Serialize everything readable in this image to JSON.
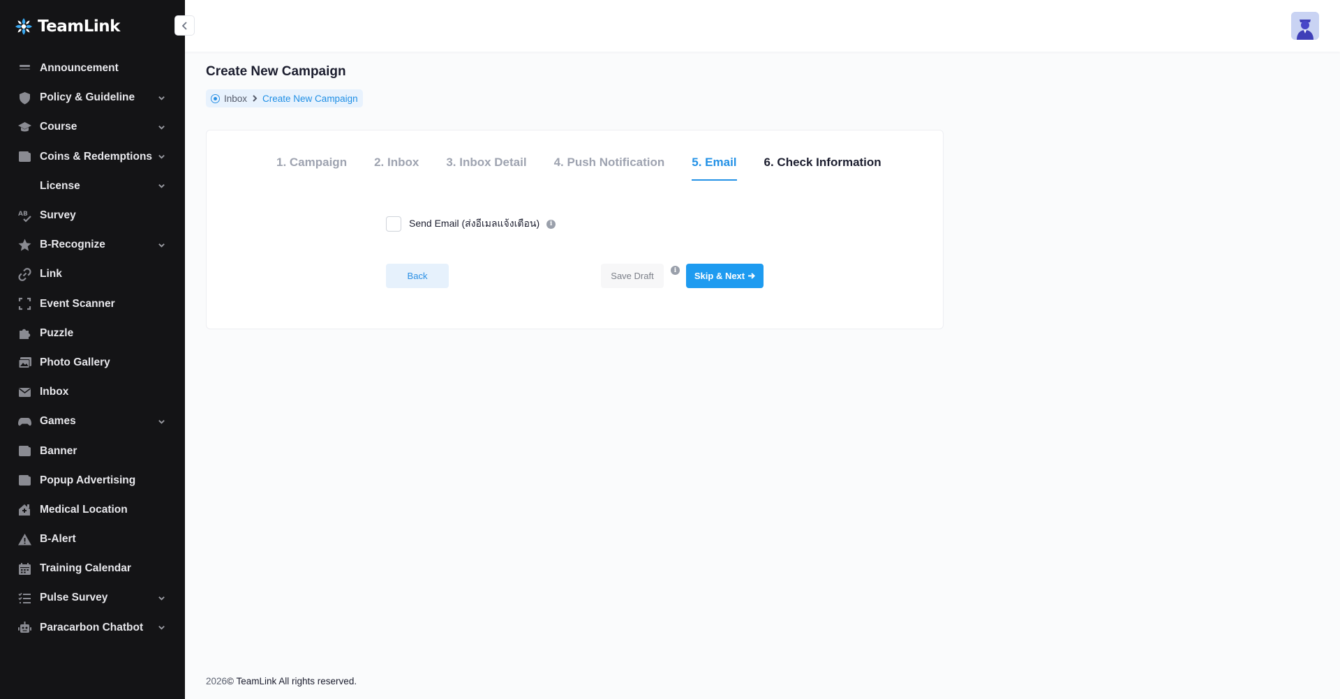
{
  "brand": {
    "name": "TeamLink"
  },
  "sidebar": {
    "items": [
      {
        "label": "Announcement",
        "icon": "announcement-icon",
        "chevron": false
      },
      {
        "label": "Policy & Guideline",
        "icon": "shield-icon",
        "chevron": true
      },
      {
        "label": "Course",
        "icon": "graduation-cap-icon",
        "chevron": true
      },
      {
        "label": "Coins & Redemptions",
        "icon": "wallet-icon",
        "chevron": true
      },
      {
        "label": "License",
        "icon": "",
        "chevron": true
      },
      {
        "label": "Survey",
        "icon": "spellcheck-icon",
        "chevron": false
      },
      {
        "label": "B-Recognize",
        "icon": "star-icon",
        "chevron": true
      },
      {
        "label": "Link",
        "icon": "link-icon",
        "chevron": false
      },
      {
        "label": "Event Scanner",
        "icon": "scan-icon",
        "chevron": false
      },
      {
        "label": "Puzzle",
        "icon": "puzzle-icon",
        "chevron": false
      },
      {
        "label": "Photo Gallery",
        "icon": "gallery-icon",
        "chevron": false
      },
      {
        "label": "Inbox",
        "icon": "envelope-icon",
        "chevron": false
      },
      {
        "label": "Games",
        "icon": "gamepad-icon",
        "chevron": true
      },
      {
        "label": "Banner",
        "icon": "wallet-icon",
        "chevron": false
      },
      {
        "label": "Popup Advertising",
        "icon": "wallet-icon",
        "chevron": false
      },
      {
        "label": "Medical Location",
        "icon": "house-medical-icon",
        "chevron": false
      },
      {
        "label": "B-Alert",
        "icon": "warning-icon",
        "chevron": false
      },
      {
        "label": "Training Calendar",
        "icon": "calendar-icon",
        "chevron": false
      },
      {
        "label": "Pulse Survey",
        "icon": "list-check-icon",
        "chevron": true
      },
      {
        "label": "Paracarbon Chatbot",
        "icon": "robot-icon",
        "chevron": true
      }
    ]
  },
  "page": {
    "title": "Create New Campaign",
    "breadcrumb": {
      "home": "Inbox",
      "current": "Create New Campaign"
    }
  },
  "steps": [
    {
      "label": "1. Campaign",
      "state": "done"
    },
    {
      "label": "2. Inbox",
      "state": "done"
    },
    {
      "label": "3. Inbox Detail",
      "state": "done"
    },
    {
      "label": "4. Push Notification",
      "state": "done"
    },
    {
      "label": "5. Email",
      "state": "active"
    },
    {
      "label": "6. Check Information",
      "state": "next"
    }
  ],
  "form": {
    "send_email_label": "Send Email (ส่งอีเมลแจ้งเตือน)",
    "send_email_checked": false
  },
  "buttons": {
    "back": "Back",
    "save_draft": "Save Draft",
    "skip_next": "Skip & Next"
  },
  "footer": {
    "year": "2026",
    "text": "© TeamLink All rights reserved."
  },
  "colors": {
    "accent": "#1e9bf0",
    "sidebar_bg": "#141416"
  }
}
